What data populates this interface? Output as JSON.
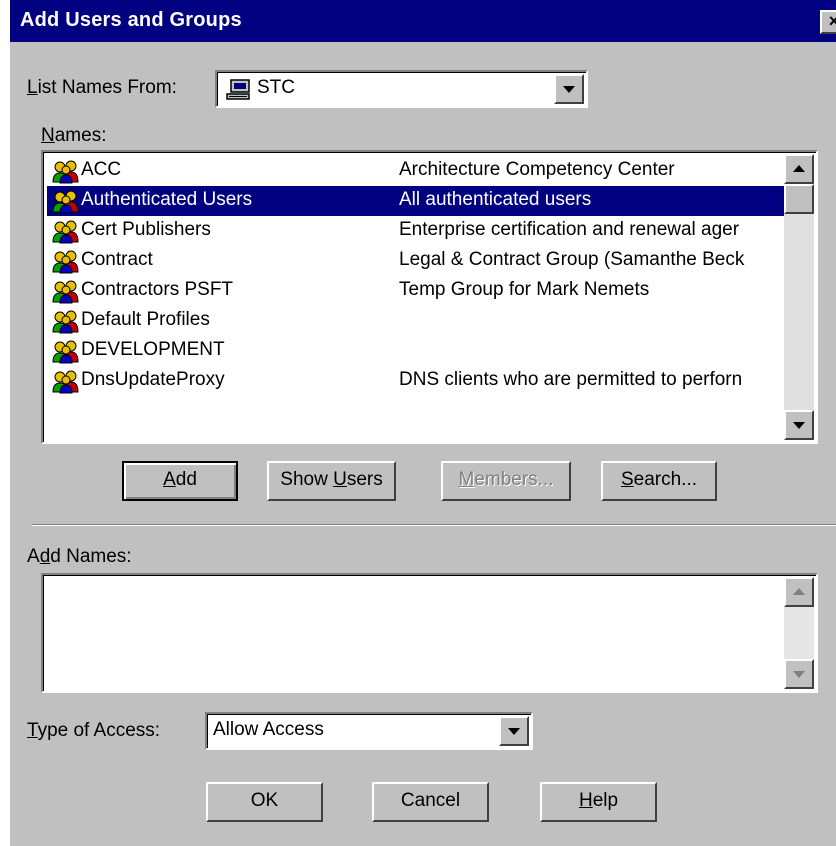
{
  "dialog": {
    "title": "Add Users and Groups",
    "close_glyph": "×"
  },
  "list_from": {
    "label_mnemonic": "L",
    "label_rest": "ist Names From:",
    "value": "STC",
    "icon": "computer-icon"
  },
  "names": {
    "label_mnemonic": "N",
    "label_rest": "ames:",
    "selected_index": 1,
    "items": [
      {
        "name": "ACC",
        "description": "Architecture Competency Center"
      },
      {
        "name": "Authenticated Users",
        "description": "All authenticated users"
      },
      {
        "name": "Cert Publishers",
        "description": "Enterprise certification and renewal ager"
      },
      {
        "name": "Contract",
        "description": "Legal & Contract Group (Samanthe Beck"
      },
      {
        "name": "Contractors PSFT",
        "description": "Temp Group for Mark Nemets"
      },
      {
        "name": "Default Profiles",
        "description": ""
      },
      {
        "name": "DEVELOPMENT",
        "description": ""
      },
      {
        "name": "DnsUpdateProxy",
        "description": "DNS clients who are permitted to perforn"
      }
    ],
    "item_icon": "user-group-icon"
  },
  "buttons": {
    "add": {
      "mnemonic": "A",
      "rest": "dd"
    },
    "show_users": {
      "pre": "Show ",
      "mnemonic": "U",
      "rest": "sers"
    },
    "members": {
      "mnemonic": "M",
      "rest": "embers...",
      "disabled": true
    },
    "search": {
      "mnemonic": "S",
      "rest": "earch..."
    }
  },
  "add_names": {
    "label_pre": "A",
    "label_mnemonic": "d",
    "label_rest": "d Names:",
    "value": ""
  },
  "type_of_access": {
    "label_mnemonic": "T",
    "label_rest": "ype of Access:",
    "value": "Allow Access"
  },
  "footer": {
    "ok": "OK",
    "cancel": "Cancel",
    "help": {
      "mnemonic": "H",
      "rest": "elp"
    }
  },
  "colors": {
    "face": "#c0c0c0",
    "title_bg": "#000080",
    "selection": "#000080"
  }
}
